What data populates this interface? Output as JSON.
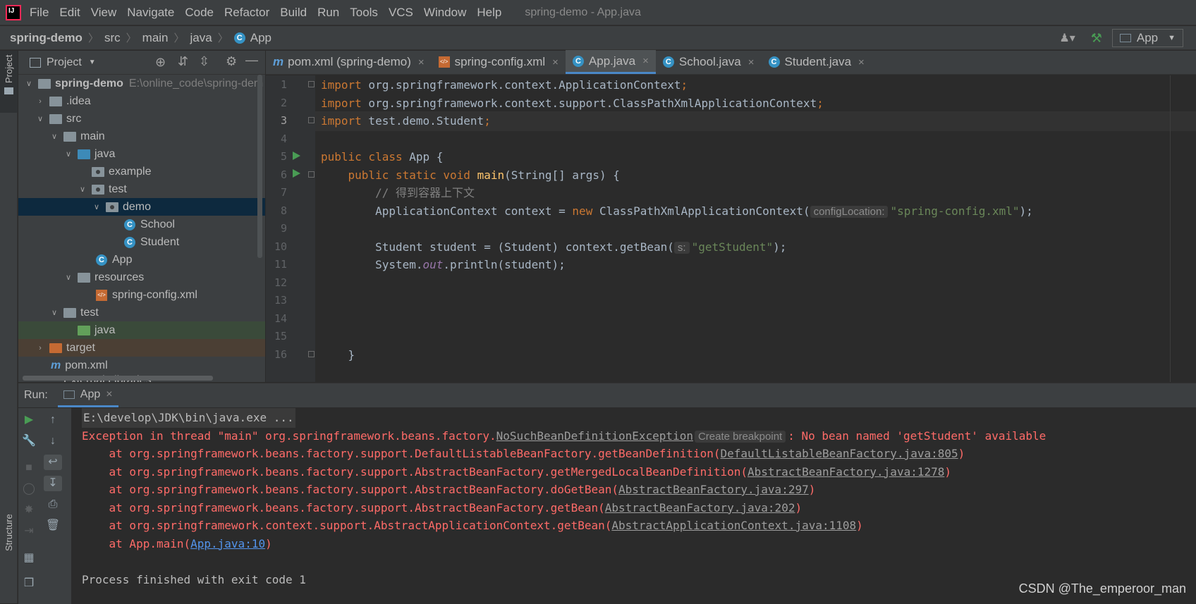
{
  "menubar": {
    "items": [
      "File",
      "Edit",
      "View",
      "Navigate",
      "Code",
      "Refactor",
      "Build",
      "Run",
      "Tools",
      "VCS",
      "Window",
      "Help"
    ],
    "title": "spring-demo - App.java"
  },
  "navbar": {
    "crumbs": [
      "spring-demo",
      "src",
      "main",
      "java",
      "App"
    ],
    "run_config": "App"
  },
  "side_strip": {
    "top_label": "Project",
    "bottom_label": "Structure"
  },
  "project": {
    "header": "Project",
    "tree": [
      {
        "label": "spring-demo",
        "hint": "E:\\online_code\\spring-dem"
      },
      {
        "label": ".idea"
      },
      {
        "label": "src"
      },
      {
        "label": "main"
      },
      {
        "label": "java"
      },
      {
        "label": "example"
      },
      {
        "label": "test"
      },
      {
        "label": "demo"
      },
      {
        "label": "School"
      },
      {
        "label": "Student"
      },
      {
        "label": "App"
      },
      {
        "label": "resources"
      },
      {
        "label": "spring-config.xml"
      },
      {
        "label": "test"
      },
      {
        "label": "java"
      },
      {
        "label": "target"
      },
      {
        "label": "pom.xml"
      },
      {
        "label": "External Libraries"
      }
    ]
  },
  "tabs": [
    {
      "label": "pom.xml (spring-demo)",
      "icon": "m-icon"
    },
    {
      "label": "spring-config.xml",
      "icon": "xml-icon"
    },
    {
      "label": "App.java",
      "icon": "class-icon"
    },
    {
      "label": "School.java",
      "icon": "class-icon"
    },
    {
      "label": "Student.java",
      "icon": "class-icon"
    }
  ],
  "editor": {
    "line_numbers": [
      "1",
      "2",
      "3",
      "4",
      "5",
      "6",
      "7",
      "8",
      "9",
      "10",
      "11",
      "12",
      "13",
      "14",
      "15",
      "16"
    ],
    "l1a": "import",
    "l1b": " org.springframework.context.ApplicationContext",
    "l1c": ";",
    "l2a": "import",
    "l2b": " org.springframework.context.support.ClassPathXmlApplicationContext",
    "l2c": ";",
    "l3a": "import",
    "l3b": " test.demo.Student",
    "l3c": ";",
    "l5a": "public class",
    "l5b": " App {",
    "l6a": "    public static void ",
    "l6b": "main",
    "l6c": "(String[] args) {",
    "l7": "        // 得到容器上下文",
    "l8a": "        ApplicationContext context = ",
    "l8b": "new",
    "l8c": " ClassPathXmlApplicationContext(",
    "l8hint": "configLocation:",
    "l8str": "\"spring-config.xml\"",
    "l8d": ");",
    "l10a": "        Student student = (Student) context.getBean(",
    "l10hint": "s:",
    "l10str": "\"getStudent\"",
    "l10b": ");",
    "l11a": "        System.",
    "l11b": "out",
    "l11c": ".println(student);",
    "l16": "    }"
  },
  "run": {
    "label": "Run:",
    "tab": "App",
    "console": {
      "cmd": "E:\\develop\\JDK\\bin\\java.exe ...",
      "exc_prefix": "Exception in thread \"main\" org.springframework.beans.factory.",
      "exc_link": "NoSuchBeanDefinitionException",
      "exc_hint": "Create breakpoint",
      "exc_suffix": ": No bean named 'getStudent' available",
      "frames": [
        {
          "text": "    at org.springframework.beans.factory.support.DefaultListableBeanFactory.getBeanDefinition(",
          "link": "DefaultListableBeanFactory.java:805",
          "end": ")"
        },
        {
          "text": "    at org.springframework.beans.factory.support.AbstractBeanFactory.getMergedLocalBeanDefinition(",
          "link": "AbstractBeanFactory.java:1278",
          "end": ")"
        },
        {
          "text": "    at org.springframework.beans.factory.support.AbstractBeanFactory.doGetBean(",
          "link": "AbstractBeanFactory.java:297",
          "end": ")"
        },
        {
          "text": "    at org.springframework.beans.factory.support.AbstractBeanFactory.getBean(",
          "link": "AbstractBeanFactory.java:202",
          "end": ")"
        },
        {
          "text": "    at org.springframework.context.support.AbstractApplicationContext.getBean(",
          "link": "AbstractApplicationContext.java:1108",
          "end": ")"
        },
        {
          "text": "    at App.main(",
          "link": "App.java:10",
          "end": ")"
        }
      ],
      "exit": "Process finished with exit code 1"
    }
  },
  "watermark": "CSDN @The_emperoor_man"
}
